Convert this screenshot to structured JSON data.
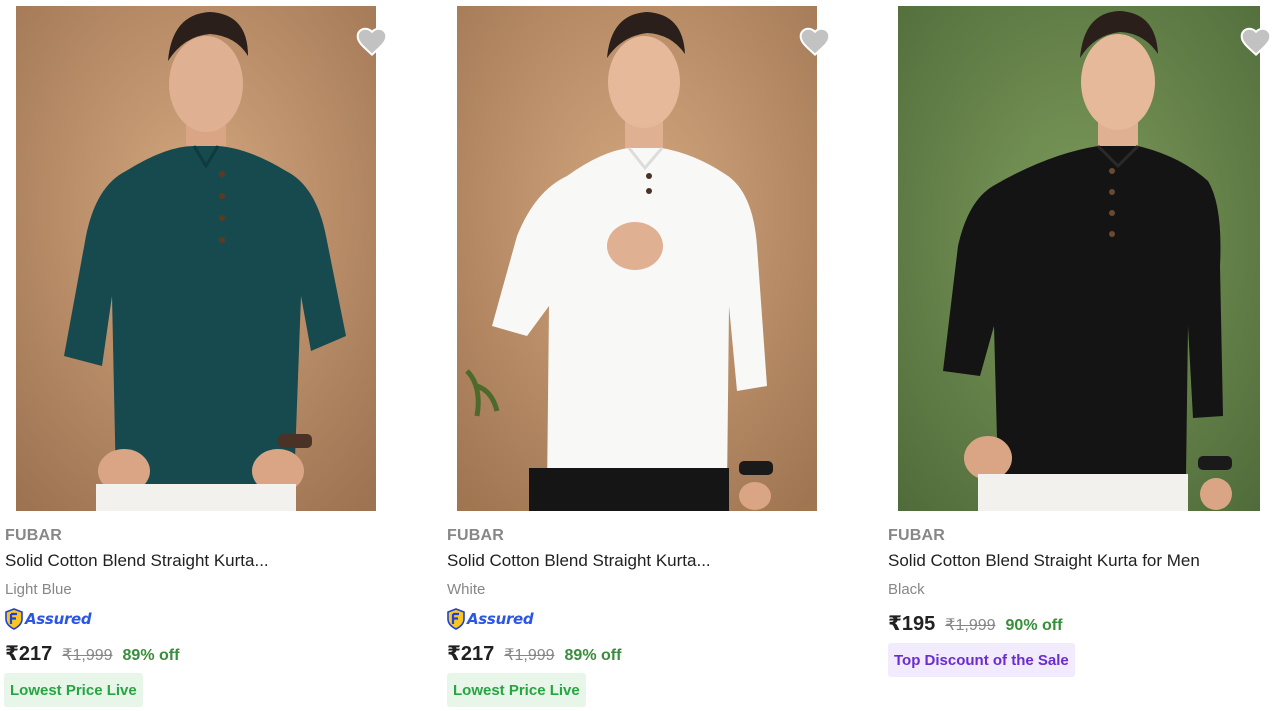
{
  "products": [
    {
      "brand": "FUBAR",
      "title": "Solid Cotton Blend Straight Kurta...",
      "color": "Light Blue",
      "assured_label": "Assured",
      "price": "₹217",
      "mrp": "₹1,999",
      "discount": "89% off",
      "tag": "Lowest Price Live",
      "image_icon": "kurta-model-teal-image"
    },
    {
      "brand": "FUBAR",
      "title": "Solid Cotton Blend Straight Kurta...",
      "color": "White",
      "assured_label": "Assured",
      "price": "₹217",
      "mrp": "₹1,999",
      "discount": "89% off",
      "tag": "Lowest Price Live",
      "image_icon": "kurta-model-white-image"
    },
    {
      "brand": "FUBAR",
      "title": "Solid Cotton Blend Straight Kurta for Men",
      "color": "Black",
      "price": "₹195",
      "mrp": "₹1,999",
      "discount": "90% off",
      "tag": "Top Discount of the Sale",
      "image_icon": "kurta-model-black-image"
    }
  ],
  "colors": {
    "discount_green": "#388e3c",
    "tag_green_text": "#26a541",
    "tag_green_bg": "#e8f5e9",
    "tag_purple_text": "#6b2bd0",
    "tag_purple_bg": "#f1ebfd",
    "assured_blue": "#2a55e5"
  }
}
